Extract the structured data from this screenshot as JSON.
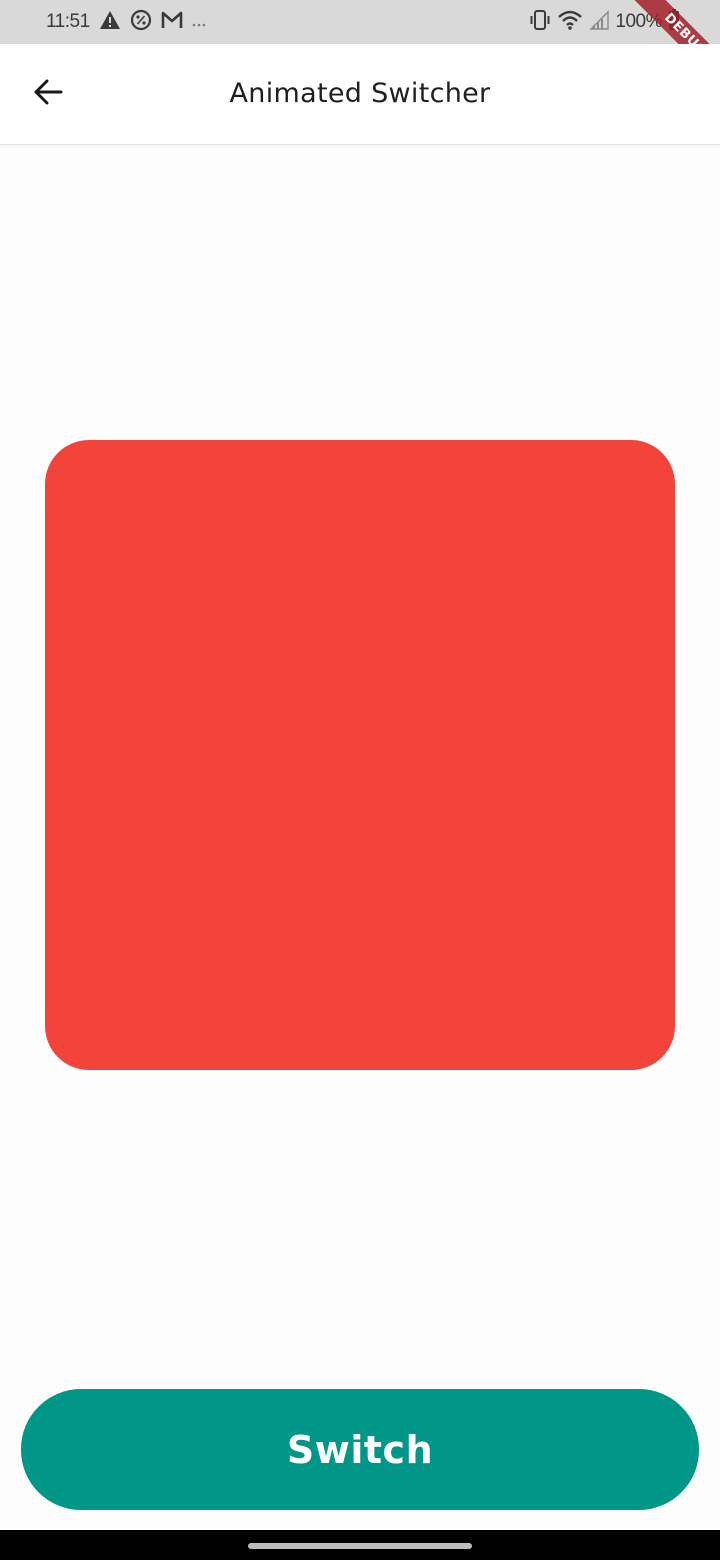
{
  "status_bar": {
    "time": "11:51",
    "battery": "100%",
    "left_icons": [
      "warning-icon",
      "percent-circle-icon",
      "gmail-icon",
      "more-dots-icon"
    ],
    "right_icons": [
      "vibrate-icon",
      "wifi-icon",
      "signal-icon",
      "battery-icon"
    ]
  },
  "debug_banner": {
    "label": "DEBUG"
  },
  "app_bar": {
    "title": "Animated Switcher",
    "back_icon": "arrow-back-icon"
  },
  "content": {
    "box_color": "#f2443a"
  },
  "switch_button": {
    "label": "Switch",
    "color": "#009688"
  }
}
